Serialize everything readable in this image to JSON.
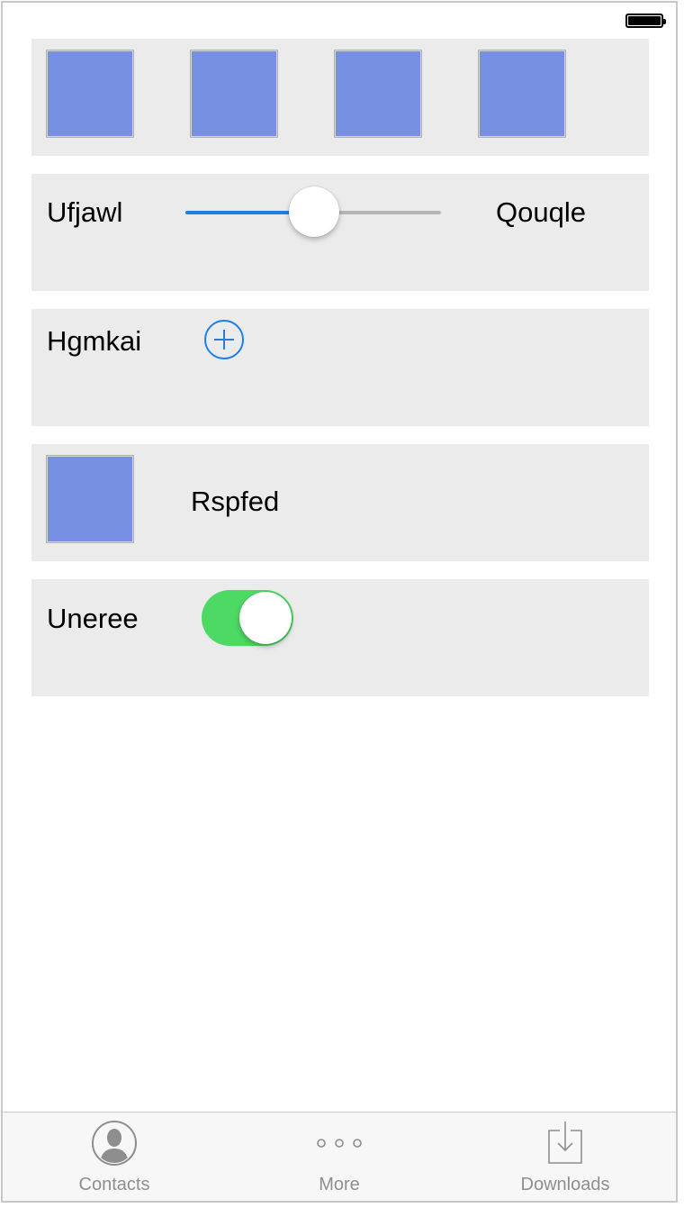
{
  "status_bar": {
    "battery_icon": "battery-full-icon",
    "battery_level": 1.0
  },
  "cards": {
    "image_row": {
      "images": [
        "image-placeholder",
        "image-placeholder",
        "image-placeholder",
        "image-placeholder"
      ]
    },
    "slider_row": {
      "left_label": "Ufjawl",
      "right_label": "Qouqle",
      "value": 0.5
    },
    "add_row": {
      "label": "Hgmkai",
      "button_icon": "plus-circle-icon"
    },
    "image_label_row": {
      "label": "Rspfed"
    },
    "toggle_row": {
      "label": "Uneree",
      "on": true
    }
  },
  "tab_bar": {
    "tabs": [
      {
        "label": "Contacts",
        "icon": "contact-person-icon"
      },
      {
        "label": "More",
        "icon": "more-dots-icon"
      },
      {
        "label": "Downloads",
        "icon": "download-tray-icon"
      }
    ]
  },
  "colors": {
    "accent": "#1e7fe6",
    "toggle_on": "#4cd964",
    "card_bg": "#ebebeb",
    "thumb": "#7890e4",
    "tab_inactive": "#8e8e8e"
  }
}
